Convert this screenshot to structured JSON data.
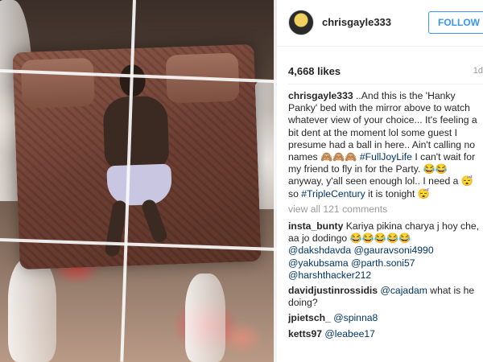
{
  "post": {
    "username": "chrisgayle333",
    "follow_label": "FOLLOW",
    "likes": "4,668 likes",
    "time_ago": "1d",
    "caption": {
      "user": "chrisgayle333",
      "text_part1": " ..And this is the 'Hanky Panky' bed with the mirror above to watch whatever view of your choice... It's feeling a bit dent at the moment lol some guest I presume had a ball in here.. Ain't calling no names ",
      "emoji1": "🙈🙈🙈",
      "hashtag1": "#FullJoyLife",
      "text_part2": " I can't wait for my friend to fly in for the Party. ",
      "emoji2": "😂😂",
      "text_part3": " anyway, y'all seen enough lol.. I need a ",
      "emoji3": "😴",
      "text_part4": " so ",
      "hashtag2": "#TripleCentury",
      "text_part5": " it is tonight ",
      "emoji4": "😴"
    },
    "view_all": "view all 121 comments",
    "comments": [
      {
        "user": "insta_bunty",
        "text": " Kariya pikina charya j hoy che, aa jo dodingo ",
        "emoji": "😂😂😂😂😂",
        "mentions": [
          "@dakshdavda",
          "@gauravsoni4990",
          "@yakubsama",
          "@parth.soni57",
          "@harshthacker212"
        ]
      },
      {
        "user": "davidjustinrossidis",
        "mention": "@cajadam",
        "text": " what is he doing?"
      },
      {
        "user": "jpietsch_",
        "mention": "@spinna8"
      },
      {
        "user": "ketts97",
        "mention": "@leabee17"
      }
    ]
  },
  "colors": {
    "link": "#003569",
    "follow": "#3897f0",
    "muted": "#999999"
  },
  "icons": {
    "avatar": "profile-avatar"
  }
}
